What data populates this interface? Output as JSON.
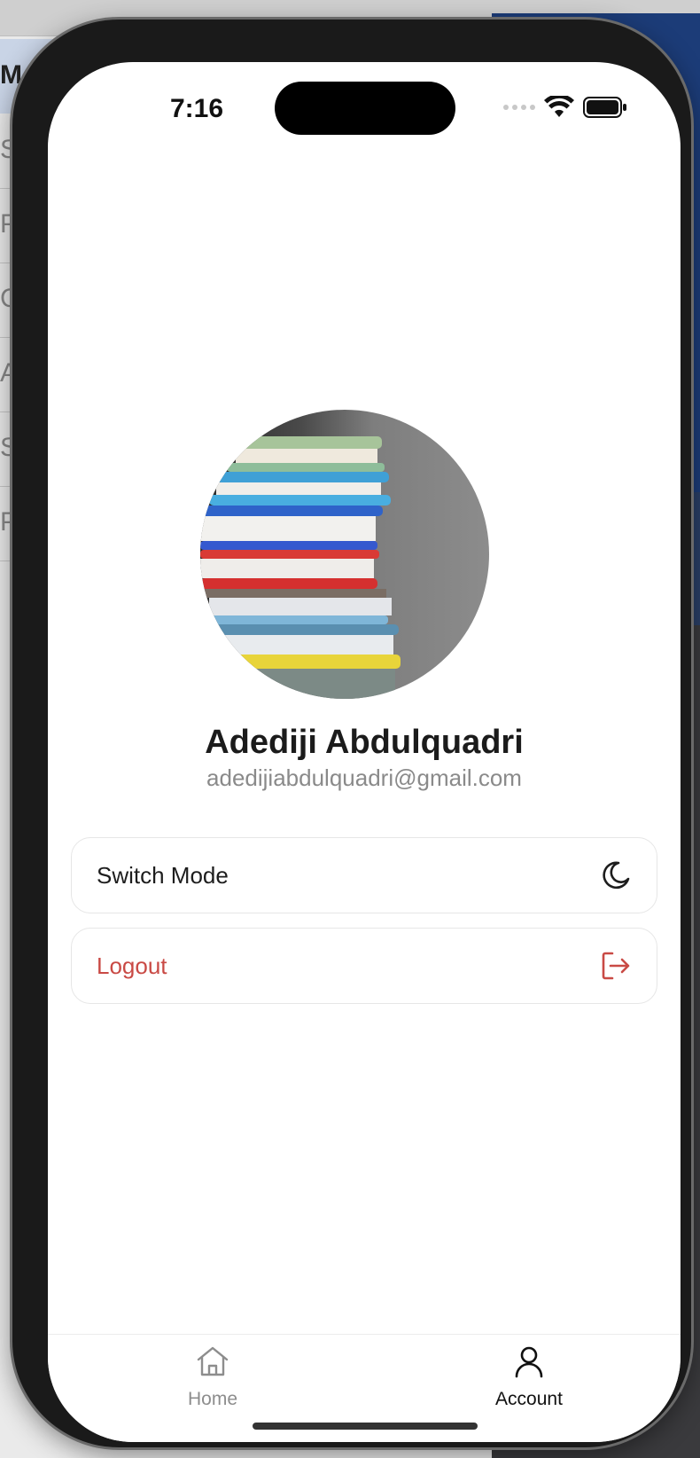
{
  "background": {
    "header_fragment": "Medi",
    "rows": [
      "Stu",
      "Por",
      "Cre",
      "App",
      "Stu",
      "Pre"
    ]
  },
  "status_bar": {
    "time": "7:16"
  },
  "profile": {
    "name": "Adediji Abdulquadri",
    "email": "adedijiabdulquadri@gmail.com",
    "avatar_icon": "stack-of-books-photo"
  },
  "menu": {
    "switch_mode": {
      "label": "Switch Mode",
      "icon": "moon-icon"
    },
    "logout": {
      "label": "Logout",
      "icon": "logout-icon",
      "color": "#c94a45"
    }
  },
  "tabbar": {
    "home": {
      "label": "Home",
      "icon": "home-icon"
    },
    "account": {
      "label": "Account",
      "icon": "person-icon",
      "active": true
    }
  }
}
